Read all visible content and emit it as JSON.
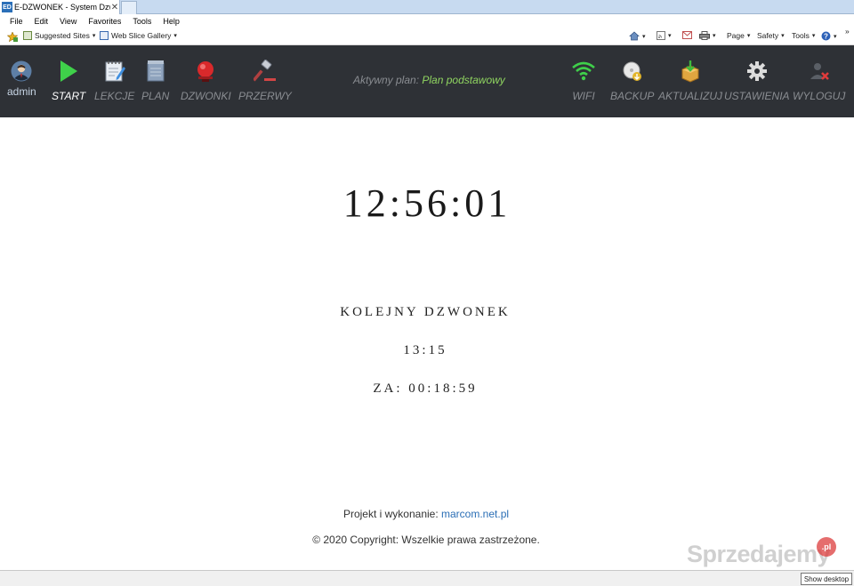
{
  "browser": {
    "tab_title": "E-DZWONEK - System Dzw...",
    "tab_close": "✕",
    "menu": [
      "File",
      "Edit",
      "View",
      "Favorites",
      "Tools",
      "Help"
    ],
    "favorites": [
      {
        "label": "Suggested Sites"
      },
      {
        "label": "Web Slice Gallery"
      }
    ],
    "commands": {
      "page": "Page",
      "safety": "Safety",
      "tools": "Tools",
      "more": "»"
    },
    "caret": "▾"
  },
  "nav": {
    "user": "admin",
    "left": [
      {
        "label": "START",
        "active": true
      },
      {
        "label": "LEKCJE"
      },
      {
        "label": "PLAN"
      },
      {
        "label": "DZWONKI"
      },
      {
        "label": "PRZERWY"
      }
    ],
    "plan_prefix": "Aktywny plan:",
    "plan_name": "Plan podstawowy",
    "right": [
      {
        "label": "WIFI"
      },
      {
        "label": "BACKUP"
      },
      {
        "label": "AKTUALIZUJ"
      },
      {
        "label": "USTAWIENIA"
      },
      {
        "label": "WYLOGUJ"
      }
    ]
  },
  "main": {
    "clock": "12:56:01",
    "next_label": "KOLEJNY DZWONEK",
    "next_time": "13:15",
    "countdown": "ZA: 00:18:59"
  },
  "footer": {
    "credit_prefix": "Projekt i wykonanie:",
    "credit_link": "marcom.net.pl",
    "copyright": "© 2020 Copyright: Wszelkie prawa zastrzeżone."
  },
  "overlay": {
    "watermark": "Sprzedajemy",
    "watermark_badge": ".pl",
    "tooltip": "Show desktop"
  },
  "colors": {
    "nav_bg": "#2e3136",
    "plan_name": "#8fd460",
    "link": "#2a6eb5",
    "active": "#ffffff"
  }
}
